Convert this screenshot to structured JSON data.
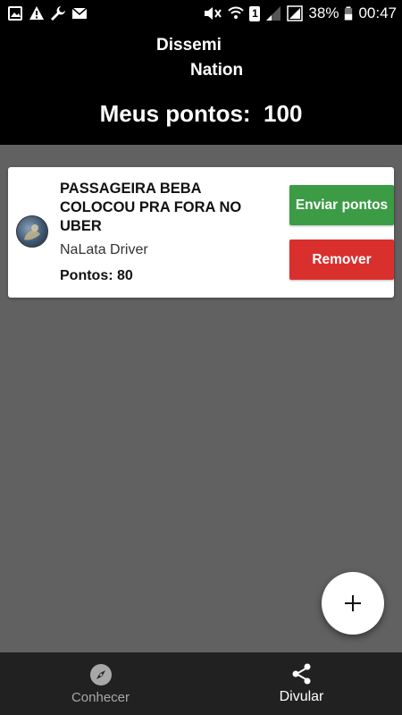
{
  "status_bar": {
    "battery": "38%",
    "time": "00:47",
    "sim_slot": "1"
  },
  "header": {
    "logo_line1": "Dissemi",
    "logo_line2": "Nation",
    "points_label": "Meus pontos:",
    "points_value": "100"
  },
  "cards": [
    {
      "title": "PASSAGEIRA BEBA COLOCOU PRA FORA NO UBER",
      "author": "NaLata Driver",
      "points_text": "Pontos: 80",
      "send_label": "Enviar pontos",
      "remove_label": "Remover"
    }
  ],
  "fab": {
    "icon": "plus-icon"
  },
  "bottom_nav": {
    "items": [
      {
        "label": "Conhecer",
        "icon": "compass-icon",
        "active": false
      },
      {
        "label": "Divular",
        "icon": "share-icon",
        "active": true
      }
    ]
  },
  "colors": {
    "header_bg": "#000000",
    "content_bg": "#616161",
    "send_button": "#3c9b45",
    "remove_button": "#d9302e",
    "nav_bg": "#212121"
  }
}
